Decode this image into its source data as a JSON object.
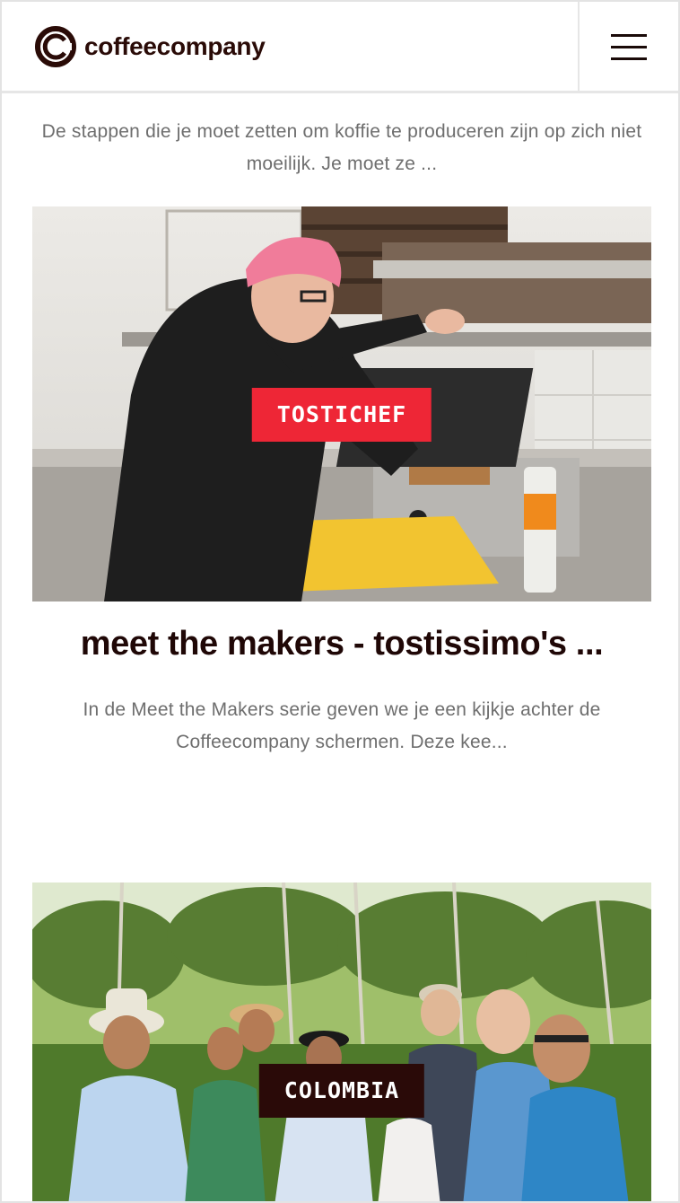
{
  "header": {
    "logo_text": "coffeecompany",
    "menu_icon": "hamburger-icon"
  },
  "posts": [
    {
      "excerpt": "De stappen die je moet zetten om koffie te produceren zijn op zich niet moeilijk. Je moet ze ..."
    },
    {
      "tag": "TOSTICHEF",
      "title": "meet the makers - tostissimo's ...",
      "excerpt": "In de Meet the Makers serie geven we je een kijkje achter de Coffeecompany schermen. Deze kee..."
    },
    {
      "tag": "COLOMBIA"
    }
  ],
  "colors": {
    "brand_dark": "#2a0b07",
    "tag_red": "#ee2636",
    "tag_dark": "#2a0a08",
    "text_gray": "#6e6e6e"
  }
}
